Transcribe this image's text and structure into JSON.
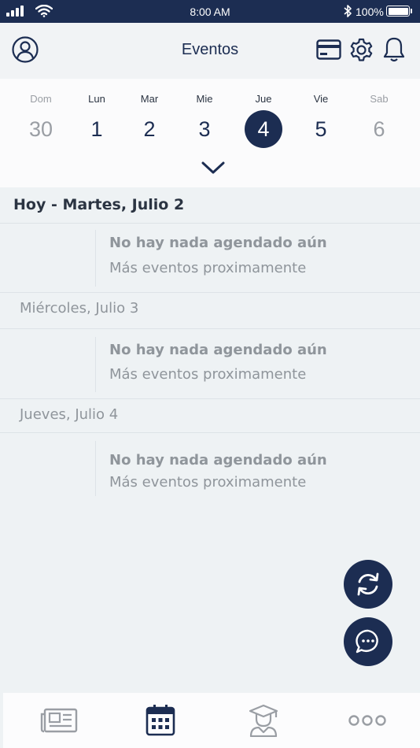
{
  "status_bar": {
    "time": "8:00 AM",
    "battery": "100%",
    "icons": [
      "signal-icon",
      "wifi-icon",
      "bluetooth-icon",
      "battery-icon"
    ]
  },
  "header": {
    "title": "Eventos",
    "icons": [
      "user-icon",
      "card-icon",
      "gear-icon",
      "bell-icon"
    ]
  },
  "week": {
    "days": [
      {
        "name": "Dom",
        "number": "30",
        "state": "muted"
      },
      {
        "name": "Lun",
        "number": "1",
        "state": "normal"
      },
      {
        "name": "Mar",
        "number": "2",
        "state": "normal"
      },
      {
        "name": "Mie",
        "number": "3",
        "state": "normal"
      },
      {
        "name": "Jue",
        "number": "4",
        "state": "selected"
      },
      {
        "name": "Vie",
        "number": "5",
        "state": "normal"
      },
      {
        "name": "Sab",
        "number": "6",
        "state": "muted"
      }
    ],
    "expand_icon": "chevron-down-icon"
  },
  "agenda": {
    "sections": [
      {
        "date": "Hoy - Martes, Julio 2",
        "empty_title": "No hay nada agendado aún",
        "empty_subtitle": "Más eventos proximamente"
      },
      {
        "date": "Miércoles, Julio 3",
        "empty_title": "No hay nada agendado aún",
        "empty_subtitle": "Más eventos proximamente"
      },
      {
        "date": "Jueves, Julio 4",
        "empty_title": "No hay nada agendado aún",
        "empty_subtitle": "Más eventos proximamente"
      }
    ]
  },
  "fabs": [
    "refresh-icon",
    "chat-icon"
  ],
  "bottom_nav": {
    "items": [
      {
        "icon": "newspaper-icon",
        "active": false
      },
      {
        "icon": "calendar-icon",
        "active": true
      },
      {
        "icon": "graduate-icon",
        "active": false
      },
      {
        "icon": "more-icon",
        "active": false
      }
    ]
  },
  "colors": {
    "primary": "#1c2d52",
    "background": "#eef2f4",
    "muted_text": "#8f959b",
    "inactive_icon": "#9a9ea4"
  }
}
